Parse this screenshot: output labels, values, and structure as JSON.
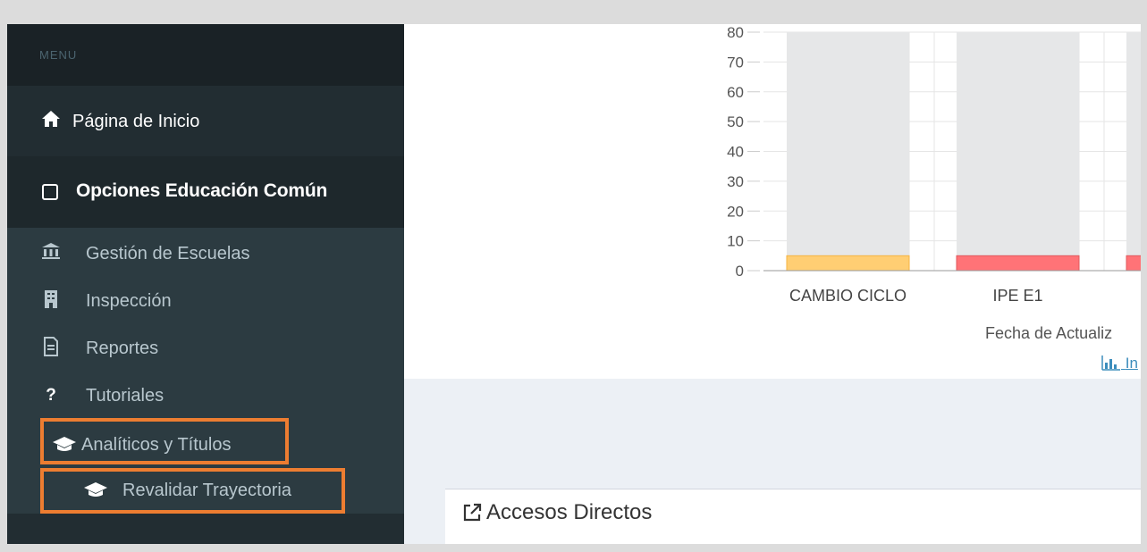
{
  "sidebar": {
    "menu_header": "MENU",
    "home": {
      "icon": "home-icon",
      "label": "Página de Inicio"
    },
    "section": {
      "icon": "square-outline-icon",
      "label": "Opciones Educación Común"
    },
    "items": [
      {
        "icon": "bank-icon",
        "label": "Gestión de Escuelas"
      },
      {
        "icon": "building-icon",
        "label": "Inspección"
      },
      {
        "icon": "document-icon",
        "label": "Reportes"
      },
      {
        "icon": "question-icon",
        "label": "Tutoriales"
      },
      {
        "icon": "graduation-cap-icon",
        "label": "Analíticos y Títulos"
      },
      {
        "icon": "graduation-cap-icon",
        "label": "Revalidar Trayectoria"
      }
    ],
    "highlight_color": "#ed7d31"
  },
  "chart_data": {
    "type": "bar",
    "categories": [
      "CAMBIO CICLO",
      "IPE E1",
      ""
    ],
    "values": [
      5,
      5,
      5
    ],
    "ylim": [
      0,
      80
    ],
    "yticks": [
      "80",
      "70",
      "60",
      "50",
      "40",
      "30",
      "20",
      "10",
      "0"
    ],
    "colors": [
      "#ffce73",
      "#ff7377",
      "#ff7377"
    ],
    "background_bar_color": "#e6e7e8",
    "grid": true
  },
  "main": {
    "update_text": "Fecha de Actualiz",
    "info_link": "In",
    "info_icon": "bar-chart-icon",
    "accesos": {
      "icon": "external-link-icon",
      "title": "Accesos Directos"
    }
  }
}
